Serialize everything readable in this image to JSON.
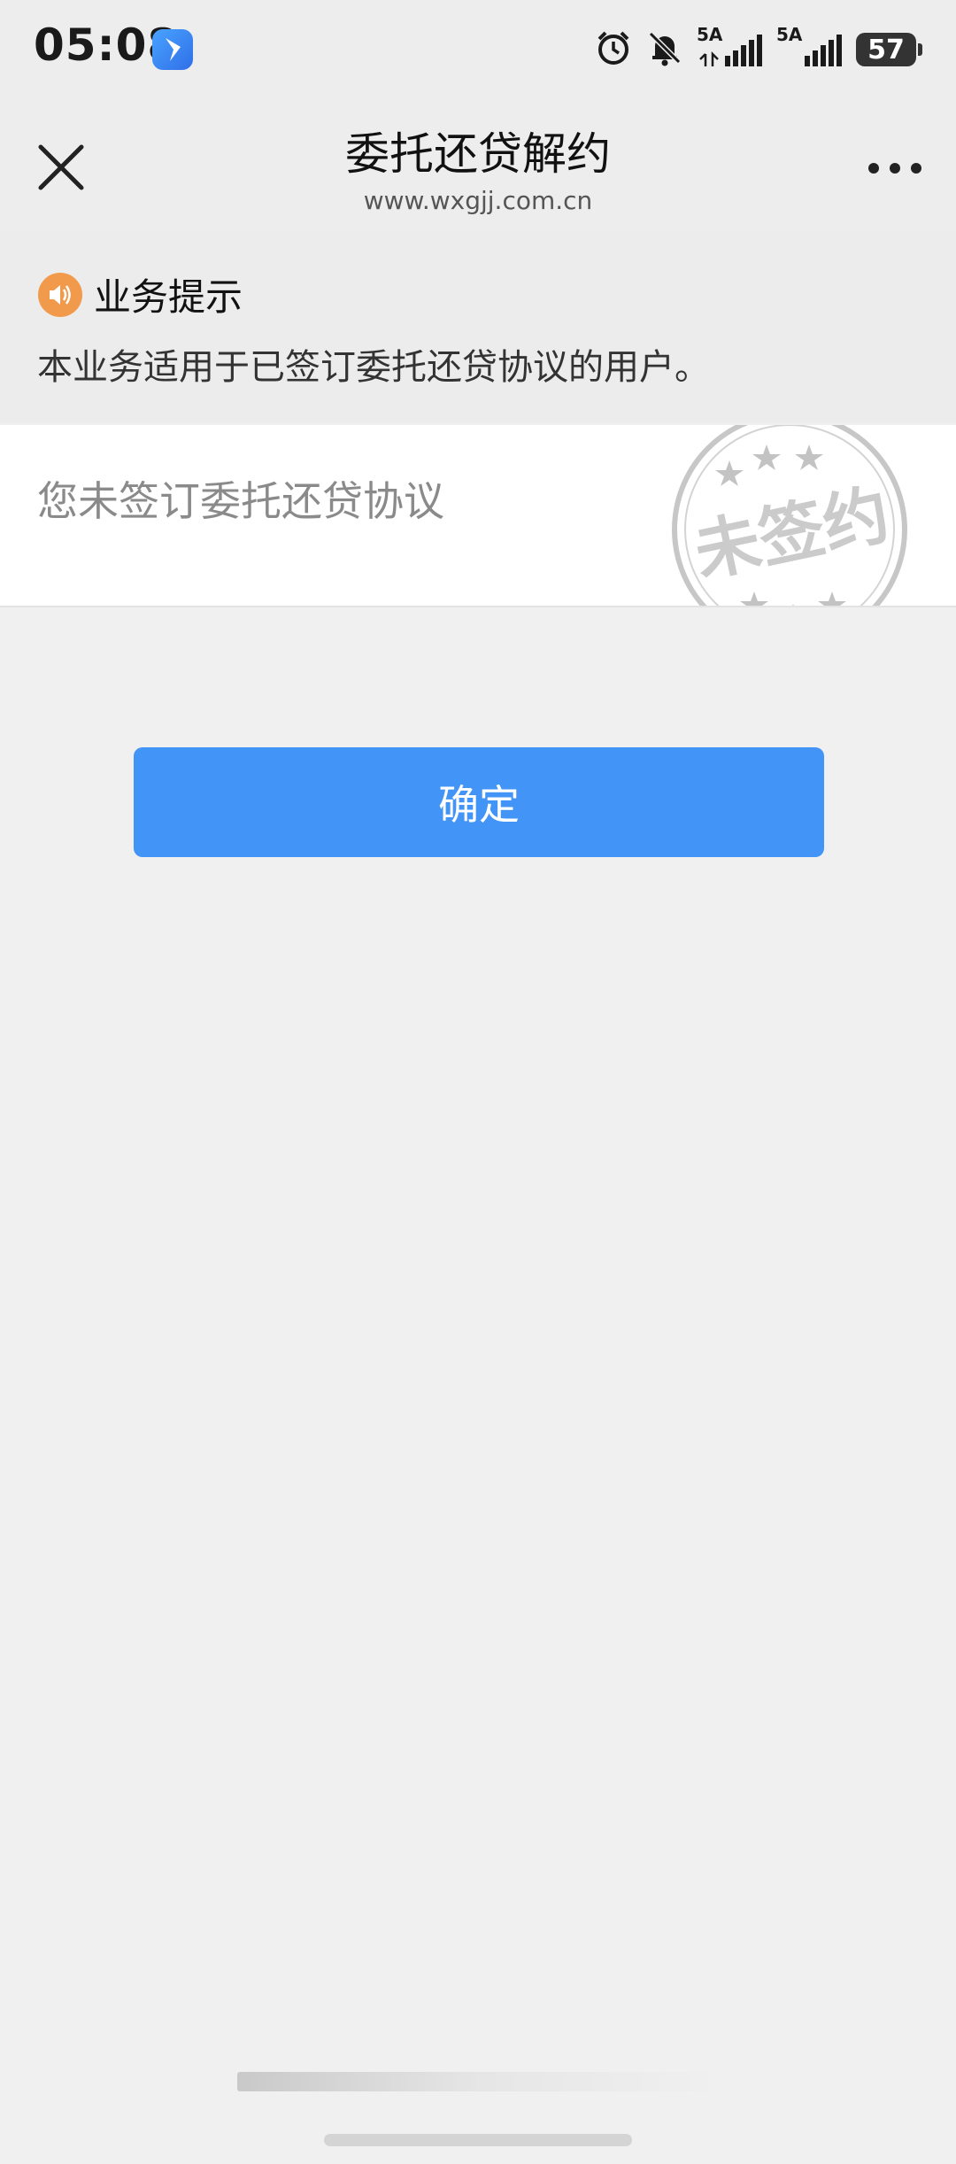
{
  "status_bar": {
    "time": "05:08",
    "network_1": "5A",
    "network_2": "5A",
    "battery": "57",
    "icons": [
      "alarm-icon",
      "mute-bell-icon",
      "signal-icon",
      "signal-icon",
      "battery-icon"
    ]
  },
  "nav": {
    "title": "委托还贷解约",
    "subtitle": "www.wxgjj.com.cn",
    "close_icon": "close-icon",
    "more_icon": "more-icon"
  },
  "notice": {
    "icon": "speaker-icon",
    "title": "业务提示",
    "body": "本业务适用于已签订委托还贷协议的用户。"
  },
  "status": {
    "text": "您未签订委托还贷协议",
    "stamp_text": "未签约"
  },
  "confirm": {
    "label": "确定",
    "color": "#4294f7"
  },
  "colors": {
    "accent": "#4294f7",
    "notice_icon": "#f29a4c",
    "background": "#f0f0f0"
  }
}
